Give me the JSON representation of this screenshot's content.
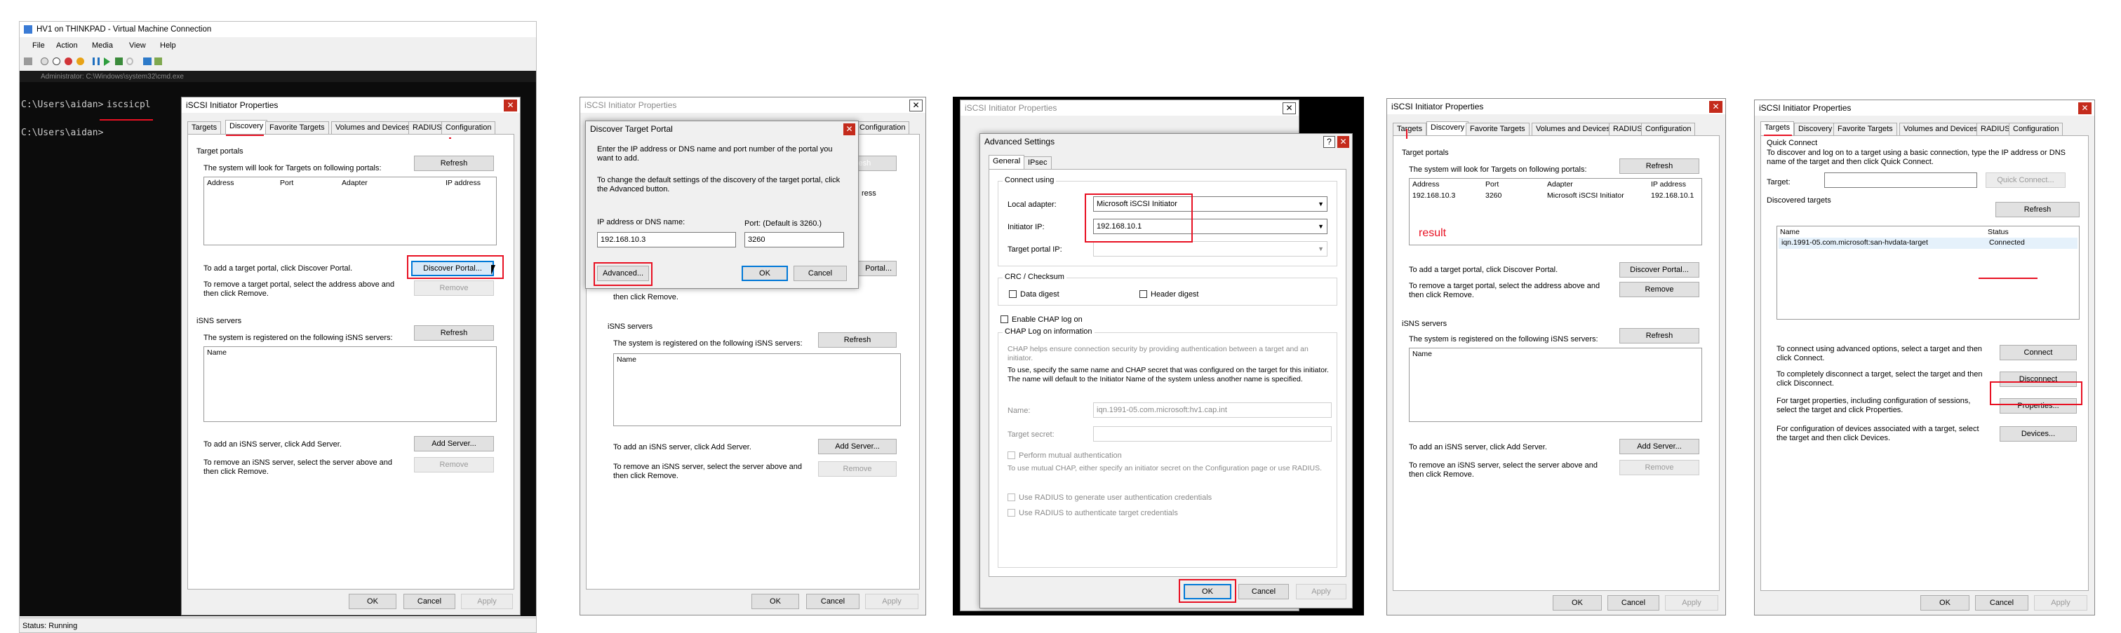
{
  "vm": {
    "title": "HV1 on THINKPAD - Virtual Machine Connection",
    "menu": [
      "File",
      "Action",
      "Media",
      "View",
      "Help"
    ],
    "cmd_title": "Administrator: C:\\Windows\\system32\\cmd.exe",
    "prompt1": "C:\\Users\\aidan>",
    "command": "iscsicpl",
    "prompt2": "C:\\Users\\aidan>",
    "status": "Status: Running"
  },
  "common": {
    "dialog_title": "iSCSI Initiator Properties",
    "tabs": [
      "Targets",
      "Discovery",
      "Favorite Targets",
      "Volumes and Devices",
      "RADIUS",
      "Configuration"
    ],
    "ok": "OK",
    "cancel": "Cancel",
    "apply": "Apply",
    "target_portals": "Target portals",
    "portals_desc": "The system will look for Targets on following portals:",
    "refresh": "Refresh",
    "col_address": "Address",
    "col_port": "Port",
    "col_adapter": "Adapter",
    "col_ip": "IP address",
    "add_portal_desc": "To add a target portal, click Discover Portal.",
    "discover_portal": "Discover Portal...",
    "remove_portal_desc": "To remove a target portal, select the address above and then click Remove.",
    "remove": "Remove",
    "isns_servers": "iSNS servers",
    "isns_desc": "The system is registered on the following iSNS servers:",
    "col_name": "Name",
    "add_isns_desc": "To add an iSNS server, click Add Server.",
    "add_server": "Add Server...",
    "remove_isns_desc": "To remove an iSNS server, select the server above and then click Remove."
  },
  "discover_dialog": {
    "title": "Discover Target Portal",
    "desc1": "Enter the IP address or DNS name and port number of the portal you want to add.",
    "desc2": "To change the default settings of the discovery of the target portal, click the Advanced button.",
    "ip_label": "IP address or DNS name:",
    "port_label": "Port: (Default is 3260.)",
    "ip_value": "192.168.10.3",
    "port_value": "3260",
    "advanced": "Advanced...",
    "ok": "OK",
    "cancel": "Cancel",
    "bg_partial_conf": "Configuration",
    "bg_partial_portal": "Portal...",
    "bg_partial_ress": "ress",
    "bg_partial_enclick": "then click Remove."
  },
  "advanced": {
    "title": "Advanced Settings",
    "help": "?",
    "tabs": [
      "General",
      "IPsec"
    ],
    "connect_using": "Connect using",
    "local_adapter_label": "Local adapter:",
    "local_adapter_value": "Microsoft iSCSI Initiator",
    "initiator_ip_label": "Initiator IP:",
    "initiator_ip_value": "192.168.10.1",
    "target_portal_ip_label": "Target portal IP:",
    "crc": "CRC / Checksum",
    "data_digest": "Data digest",
    "header_digest": "Header digest",
    "enable_chap": "Enable CHAP log on",
    "chap_info": "CHAP Log on information",
    "chap_desc": "CHAP helps ensure connection security by providing authentication between a target and an initiator.",
    "chap_desc2": "To use, specify the same name and CHAP secret that was configured on the target for this initiator. The name will default to the Initiator Name of the system unless another name is specified.",
    "name_label": "Name:",
    "name_value": "iqn.1991-05.com.microsoft:hv1.cap.int",
    "target_secret_label": "Target secret:",
    "mutual_auth": "Perform mutual authentication",
    "mutual_desc": "To use mutual CHAP, either specify an initiator secret on the Configuration page or use RADIUS.",
    "radius1": "Use RADIUS to generate user authentication credentials",
    "radius2": "Use RADIUS to authenticate target credentials",
    "ok": "OK",
    "cancel": "Cancel",
    "apply": "Apply"
  },
  "result_panel": {
    "row_address": "192.168.10.3",
    "row_port": "3260",
    "row_adapter": "Microsoft iSCSI Initiator",
    "row_ip": "192.168.10.1",
    "result_note": "result"
  },
  "targets_panel": {
    "quick_connect": "Quick Connect",
    "qc_desc": "To discover and log on to a target using a basic connection, type the IP address or DNS name of the target and then click Quick Connect.",
    "target_label": "Target:",
    "quick_connect_btn": "Quick Connect...",
    "discovered_targets": "Discovered targets",
    "refresh": "Refresh",
    "col_name": "Name",
    "col_status": "Status",
    "target_name": "iqn.1991-05.com.microsoft:san-hvdata-target",
    "target_status": "Connected",
    "connect_desc": "To connect using advanced options, select a target and then click Connect.",
    "connect": "Connect",
    "disconnect_desc": "To completely disconnect a target, select the target and then click Disconnect.",
    "disconnect": "Disconnect",
    "properties_desc": "For target properties, including configuration of sessions, select the target and click Properties.",
    "properties": "Properties...",
    "devices_desc": "For configuration of devices associated with a target, select the target and then click Devices.",
    "devices": "Devices..."
  },
  "colors": {
    "annotation": "#e81123",
    "console": "#000000",
    "dialog_bg": "#f0f0f0"
  }
}
